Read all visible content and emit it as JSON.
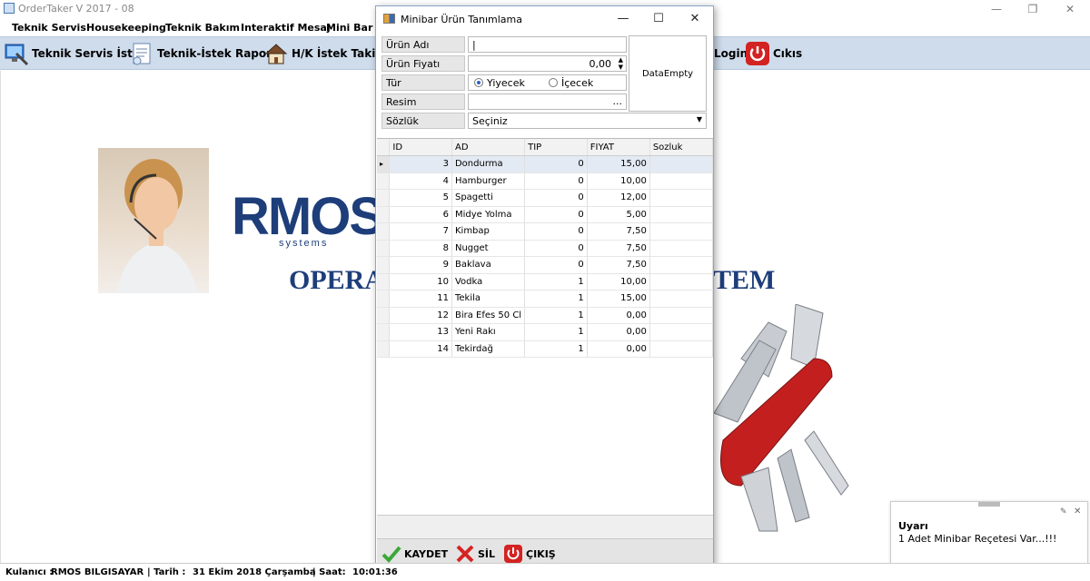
{
  "app": {
    "title": "OrderTaker V 2017 - 08"
  },
  "menu": [
    "Teknik Servis",
    "Housekeeping",
    "Teknik Bakım",
    "Interaktif Mesaj",
    "Mini Bar"
  ],
  "toolbar": {
    "teknik_servis_istek": "Teknik Servis İstek",
    "teknik_istek_raporu": "Teknik-İstek Raporu",
    "hk_istek_takip": "H/K İstek Takip",
    "login": "Login",
    "cikis": "Cıkıs"
  },
  "brand": {
    "logo": "RMOS",
    "sub": "systems",
    "line_left": "OPERA",
    "line_right": "TEM"
  },
  "dialog": {
    "title": "Minibar Ürün Tanımlama",
    "fields": {
      "urun_adi_label": "Ürün Adı",
      "urun_adi_value": "|",
      "urun_fiyati_label": "Ürün Fiyatı",
      "urun_fiyati_value": "0,00",
      "tur_label": "Tür",
      "tur_options": [
        "Yiyecek",
        "İçecek"
      ],
      "tur_selected": "Yiyecek",
      "resim_label": "Resim",
      "resim_button": "...",
      "sozluk_label": "Sözlük",
      "sozluk_value": "Seçiniz"
    },
    "photo_placeholder": "DataEmpty",
    "grid": {
      "columns": [
        "ID",
        "AD",
        "TIP",
        "FIYAT",
        "Sozluk"
      ],
      "rows": [
        [
          "3",
          "Dondurma",
          "0",
          "15,00",
          ""
        ],
        [
          "4",
          "Hamburger",
          "0",
          "10,00",
          ""
        ],
        [
          "5",
          "Spagetti",
          "0",
          "12,00",
          ""
        ],
        [
          "6",
          "Midye Yolma",
          "0",
          "5,00",
          ""
        ],
        [
          "7",
          "Kimbap",
          "0",
          "7,50",
          ""
        ],
        [
          "8",
          "Nugget",
          "0",
          "7,50",
          ""
        ],
        [
          "9",
          "Baklava",
          "0",
          "7,50",
          ""
        ],
        [
          "10",
          "Vodka",
          "1",
          "10,00",
          ""
        ],
        [
          "11",
          "Tekila",
          "1",
          "15,00",
          ""
        ],
        [
          "12",
          "Bira Efes 50 Cl",
          "1",
          "0,00",
          ""
        ],
        [
          "13",
          "Yeni Rakı",
          "1",
          "0,00",
          ""
        ],
        [
          "14",
          "Tekirdağ",
          "1",
          "0,00",
          ""
        ]
      ]
    },
    "buttons": {
      "kaydet": "KAYDET",
      "sil": "SİL",
      "cikis": "ÇIKIŞ"
    }
  },
  "status": {
    "user_label": "Kulanıcı :",
    "user_value": "RMOS BILGISAYAR",
    "date_label": "| Tarih :",
    "date_value": "31 Ekim 2018 Çarşamba",
    "time_label": "| Saat:",
    "time_value": "10:01:36"
  },
  "notification": {
    "title": "Uyarı",
    "message": "1 Adet Minibar Reçetesi Var...!!!"
  },
  "colors": {
    "brand_blue": "#1e3e7a",
    "brand_red": "#d8252c",
    "toolbar_bg": "#cfdcec"
  }
}
